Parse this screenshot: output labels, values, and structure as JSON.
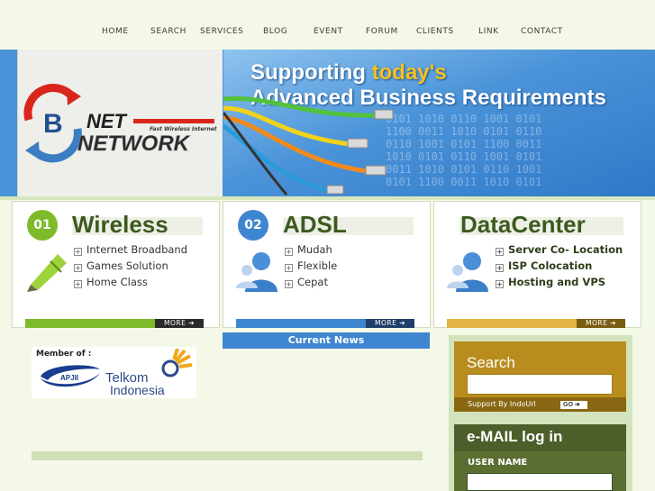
{
  "nav": {
    "items": [
      "HOME",
      "SEARCH",
      "SERVICES",
      "BLOG",
      "EVENT",
      "FORUM",
      "CLIENTS",
      "LINK",
      "CONTACT"
    ]
  },
  "banner": {
    "logo_text": "NET",
    "logo_subtext": "NETWORK",
    "logo_letter": "B",
    "logo_tagline": "Fast Wireless Internet",
    "hero_line1_prefix": "Supporting ",
    "hero_line1_highlight": "today's",
    "hero_line2": "Advanced Business Requirements"
  },
  "services": [
    {
      "num": "01",
      "title": "Wireless",
      "items": [
        "Internet Broadband",
        "Games Solution",
        "Home Class"
      ],
      "more": "MORE",
      "color": "#7dbb2a"
    },
    {
      "num": "02",
      "title": "ADSL",
      "items": [
        "Mudah",
        "Flexible",
        "Cepat"
      ],
      "more": "MORE",
      "color": "#3f86d1"
    },
    {
      "num": "",
      "title": "DataCenter",
      "items": [
        "Server Co- Location",
        "ISP Colocation",
        "Hosting and VPS"
      ],
      "more": "MORE",
      "color": "#e3b545"
    }
  ],
  "news": {
    "heading": "Current News"
  },
  "member": {
    "label": "Member of :",
    "org1": "APJII",
    "org2_line1": "Telkom",
    "org2_line2": "Indonesia"
  },
  "sidebar": {
    "search_title": "Search",
    "search_value": "",
    "support_text": "Support By IndoUrl",
    "go_label": "GO",
    "email_title": "e-MAIL log in",
    "user_label": "USER NAME",
    "user_value": ""
  },
  "colors": {
    "page_bg": "#f3f9e6",
    "accent_green": "#7dbb2a",
    "accent_blue": "#3f86d1",
    "accent_gold": "#b88d1d",
    "dark_green": "#5a6e32"
  }
}
